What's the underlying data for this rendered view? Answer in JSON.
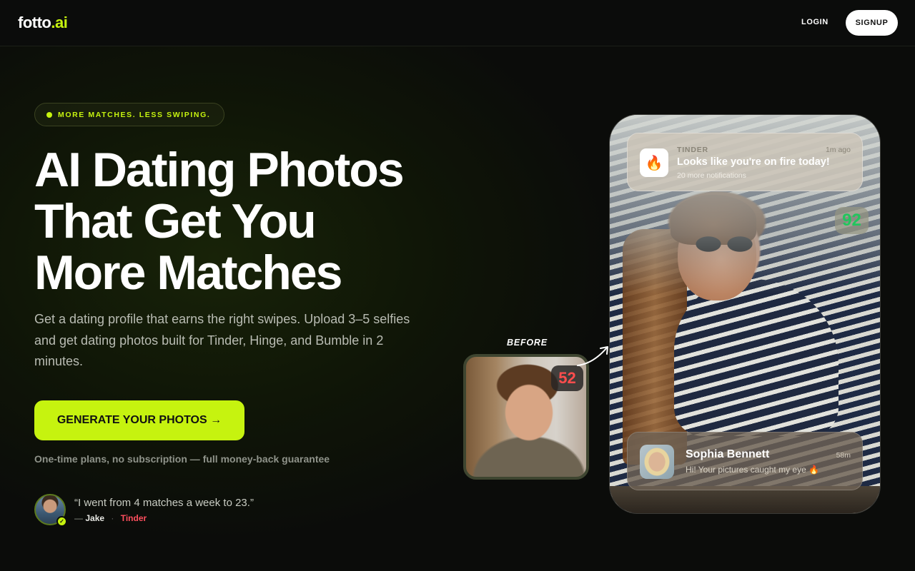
{
  "nav": {
    "logo_main": "fotto",
    "logo_accent": ".ai",
    "login_label": "LOGIN",
    "signup_label": "SIGNUP"
  },
  "hero": {
    "badge": "MORE MATCHES. LESS SWIPING.",
    "headline_lines": [
      "AI Dating Photos",
      "That Get You",
      "More Matches"
    ],
    "subtext": "Get a dating profile that earns the right swipes. Upload 3–5 selfies and get dating photos built for Tinder, Hinge, and Bumble in 2 minutes.",
    "cta_label": "GENERATE YOUR PHOTOS →",
    "guarantee": "One-time plans, no subscription — full money-back guarantee"
  },
  "testimonial": {
    "quote": "“I went from 4 matches a week to 23.”",
    "dash": "—",
    "name": "Jake",
    "separator": "·",
    "app": "Tinder"
  },
  "before": {
    "label": "BEFORE",
    "score": "52"
  },
  "after": {
    "score": "92",
    "notification": {
      "app": "TINDER",
      "time": "1m ago",
      "title": "Looks like you're on fire today!",
      "subtitle": "20 more notifications",
      "icon": "fire-icon"
    },
    "message": {
      "name": "Sophia Bennett",
      "time": "58m",
      "text": "Hi! Your pictures caught my eye 🔥"
    }
  },
  "colors": {
    "accent": "#c6f30f",
    "score_low": "#ff4d4d",
    "score_high": "#22c55e",
    "tinder": "#ff4f5e"
  }
}
